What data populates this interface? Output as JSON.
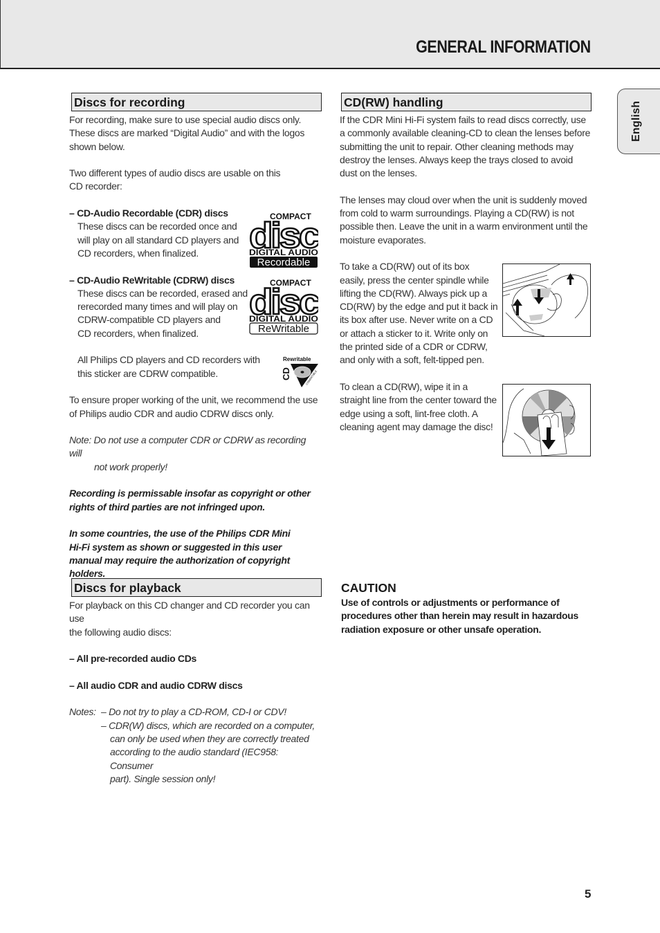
{
  "header": {
    "title": "GENERAL INFORMATION"
  },
  "language_tab": "English",
  "page_number": "5",
  "discs_for_recording": {
    "heading": "Discs for recording",
    "intro": [
      "For recording, make sure to use special audio discs only.",
      "These discs are marked “Digital Audio” and with the logos",
      "shown below."
    ],
    "types_intro": [
      "Two different types of audio discs are usable on this",
      "CD recorder:"
    ],
    "cdr": {
      "title": "– CD-Audio Recordable (CDR) discs",
      "lines": [
        "These discs can be recorded once and",
        "will play on all standard CD players and",
        "CD recorders, when finalized."
      ],
      "logo_top": "COMPACT",
      "logo_main": "disc",
      "logo_sub": "DIGITAL AUDIO",
      "logo_badge": "Recordable"
    },
    "cdrw": {
      "title": "– CD-Audio ReWritable (CDRW) discs",
      "lines": [
        "These discs can be recorded, erased and",
        "rerecorded many times and will play on",
        "CDRW-compatible CD players and",
        "CD recorders, when finalized."
      ],
      "logo_top": "COMPACT",
      "logo_main": "disc",
      "logo_sub": "DIGITAL AUDIO",
      "logo_badge": "ReWritable"
    },
    "sticker": {
      "lines": [
        "All Philips CD players and CD recorders with",
        "this sticker are CDRW compatible."
      ],
      "logo_top": "Rewritable",
      "logo_side": "CD",
      "logo_edge": "COMPATIBLE"
    },
    "recommend": [
      "To ensure proper working of the unit, we recommend the use",
      "of Philips audio CDR and audio CDRW discs only."
    ],
    "note": [
      "Note: Do not use a computer CDR or CDRW as recording will",
      "not work properly!"
    ],
    "copyright1": [
      "Recording is permissable insofar as copyright or other",
      "rights of third parties are not infringed upon."
    ],
    "copyright2": [
      "In some countries, the use of the Philips CDR Mini",
      "Hi-Fi system as shown or suggested in this user",
      "manual may require the authorization of copyright",
      "holders."
    ]
  },
  "discs_for_playback": {
    "heading": "Discs for playback",
    "intro": [
      "For playback on this CD changer and CD recorder you can use",
      "the following audio discs:"
    ],
    "item1": "– All pre-recorded audio CDs",
    "item2": "– All audio CDR and audio CDRW discs",
    "notes_label": "Notes:",
    "note1": "–  Do not try to play a CD-ROM, CD-I or CDV!",
    "note2": [
      "–  CDR(W) discs, which are recorded on a computer,",
      "can only be used when they are correctly treated",
      "according to the audio standard (IEC958: Consumer",
      "part). Single session only!"
    ]
  },
  "cdrw_handling": {
    "heading": "CD(RW) handling",
    "para1": [
      "If the CDR Mini Hi-Fi system fails to read discs correctly, use",
      "a commonly available cleaning-CD to clean the lenses before",
      "submitting the unit to repair. Other cleaning methods may",
      "destroy the lenses. Always keep the trays closed to avoid",
      "dust on the lenses."
    ],
    "para2": [
      "The lenses may cloud over when the unit is suddenly moved",
      "from cold to warm surroundings. Playing a CD(RW) is not",
      "possible then. Leave the unit in a warm environment until the",
      "moisture evaporates."
    ],
    "para3": [
      "To take a CD(RW) out of its box",
      "easily, press the center spindle while",
      "lifting the CD(RW). Always pick up a",
      "CD(RW) by the edge and put it back in",
      "its box after use. Never write on a CD",
      "or attach a sticker to it. Write only on",
      "the printed side of a CDR or CDRW,",
      "and only with a soft, felt-tipped pen."
    ],
    "para4": [
      "To clean a CD(RW), wipe it in a",
      "straight line from the center toward the",
      "edge using a soft, lint-free cloth. A",
      "cleaning agent may damage the disc!"
    ]
  },
  "caution": {
    "heading": "CAUTION",
    "lines": [
      "Use of controls or adjustments or performance of",
      "procedures other than herein may result in hazardous",
      "radiation exposure or other unsafe operation."
    ]
  }
}
